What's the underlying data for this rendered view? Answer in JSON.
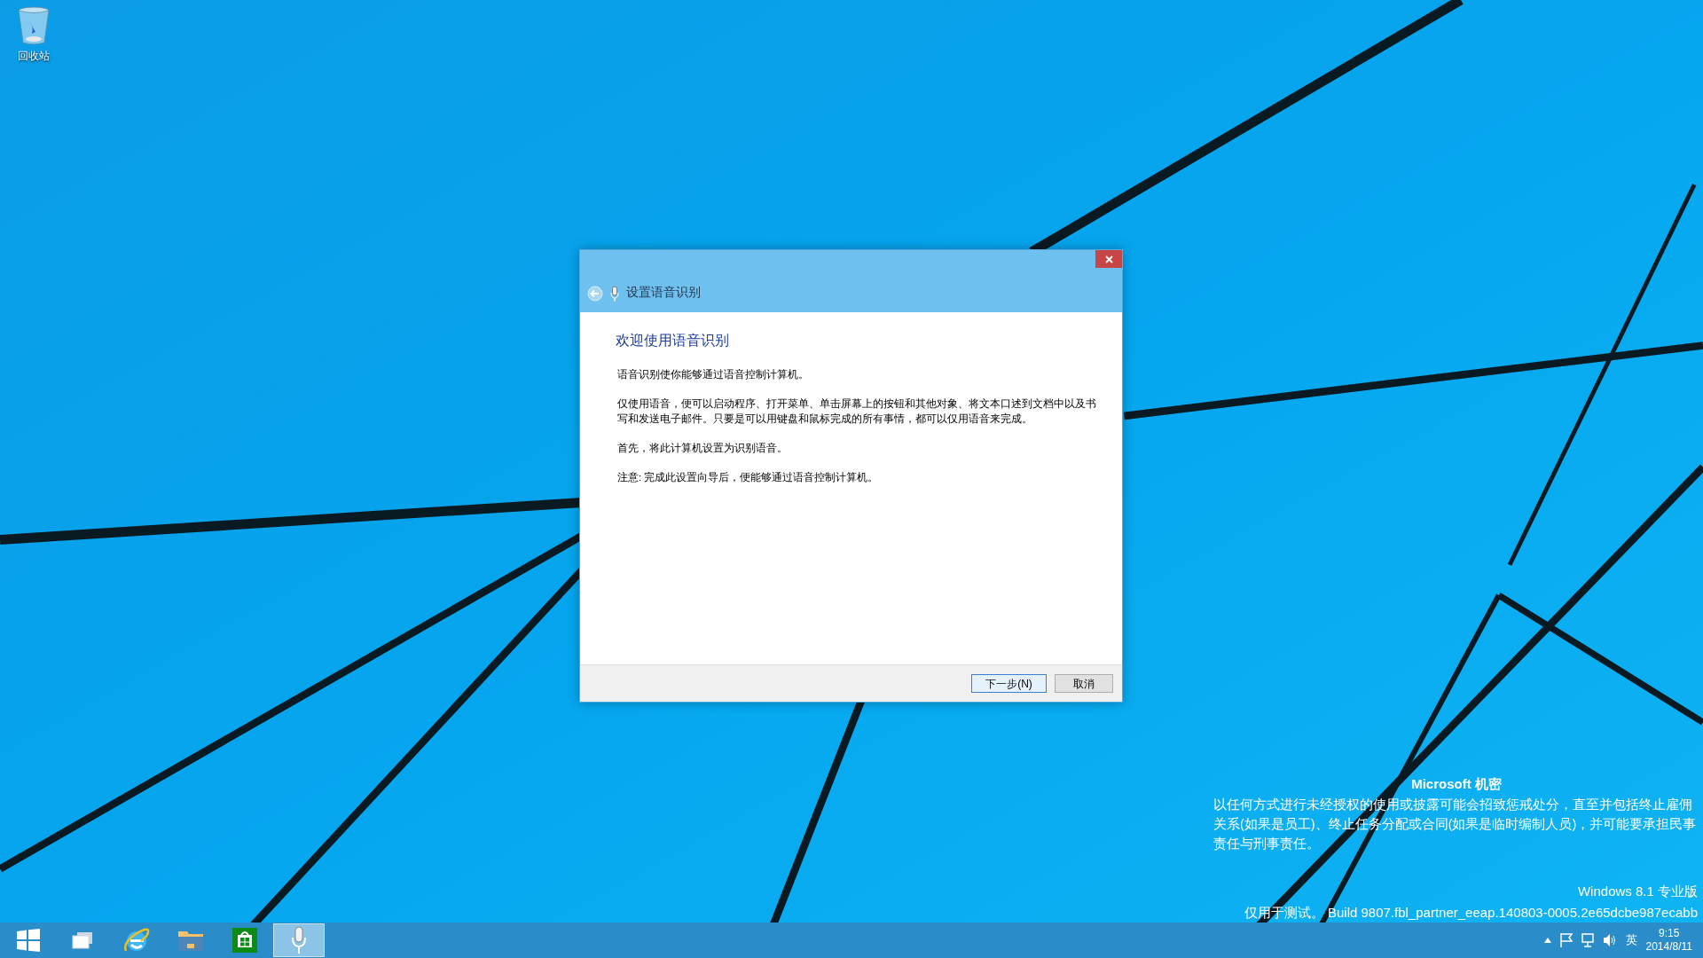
{
  "desktop": {
    "icons": [
      {
        "label": "回收站"
      }
    ]
  },
  "dialog": {
    "title": "设置语音识别",
    "heading": "欢迎使用语音识别",
    "paragraphs": [
      "语音识别使你能够通过语音控制计算机。",
      "仅使用语音，便可以启动程序、打开菜单、单击屏幕上的按钮和其他对象、将文本口述到文档中以及书写和发送电子邮件。只要是可以用键盘和鼠标完成的所有事情，都可以仅用语音来完成。",
      "首先，将此计算机设置为识别语音。",
      "注意: 完成此设置向导后，便能够通过语音控制计算机。"
    ],
    "buttons": [
      {
        "label": "下一步(N)",
        "default": true
      },
      {
        "label": "取消",
        "default": false
      }
    ]
  },
  "notice": {
    "title": "Microsoft 机密",
    "body": "以任何方式进行未经授权的使用或披露可能会招致惩戒处分，直至并包括终止雇佣关系(如果是员工)、终止任务分配或合同(如果是临时编制人员)，并可能要承担民事责任与刑事责任。",
    "edition": "Windows 8.1 专业版",
    "build": "仅用于测试。 Build 9807.fbl_partner_eeap.140803-0005.2e65dcbe987ecabb"
  },
  "taskbar": {
    "apps": [
      {
        "kind": "start",
        "selected": false
      },
      {
        "kind": "task-view",
        "selected": false
      },
      {
        "kind": "browser",
        "selected": false
      },
      {
        "kind": "folder",
        "selected": false
      },
      {
        "kind": "store",
        "selected": false
      },
      {
        "kind": "microphone",
        "selected": true
      }
    ],
    "tray": {
      "input_language": "英",
      "time": "9:15",
      "date": "2014/8/11"
    }
  }
}
